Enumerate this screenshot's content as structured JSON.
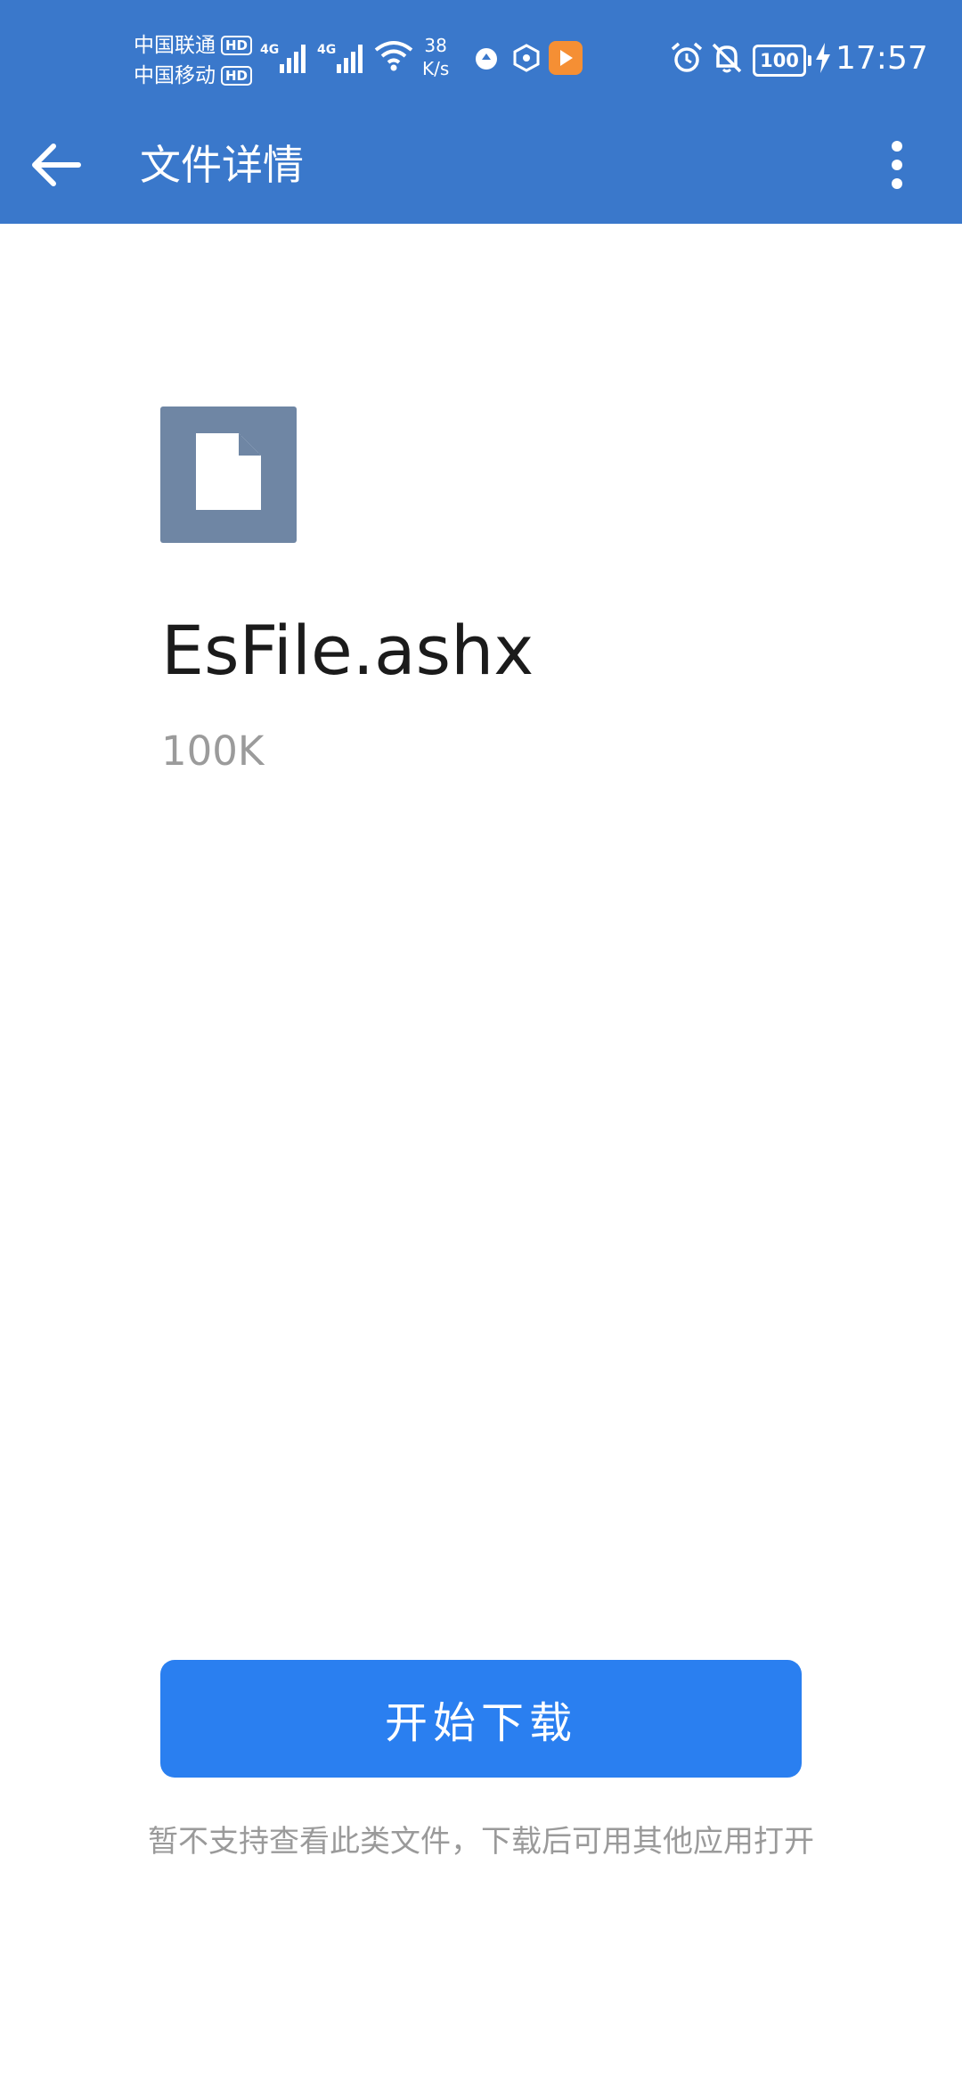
{
  "status_bar": {
    "carrier_1": "中国联通",
    "carrier_2": "中国移动",
    "hd_badge": "HD",
    "network_type": "4G",
    "net_speed_value": "38",
    "net_speed_unit": "K/s",
    "battery": "100",
    "time": "17:57",
    "icons": [
      "signal-icon",
      "wifi-icon",
      "app-notification-icon",
      "vpn-icon",
      "video-app-icon",
      "alarm-icon",
      "mute-bell-icon",
      "battery-icon",
      "charging-bolt-icon"
    ]
  },
  "app_bar": {
    "title": "文件详情",
    "back_icon": "arrow-left-icon",
    "menu_icon": "more-vertical-icon"
  },
  "file": {
    "name": "EsFile.ashx",
    "size": "100K",
    "icon": "document-icon"
  },
  "actions": {
    "download_label": "开始下载"
  },
  "hint": {
    "text": "暂不支持查看此类文件，下载后可用其他应用打开"
  },
  "colors": {
    "app_bar": "#3a78cb",
    "button": "#2a7ff0",
    "file_icon_bg": "#6f86a4",
    "secondary_text": "#9a9a9a"
  }
}
